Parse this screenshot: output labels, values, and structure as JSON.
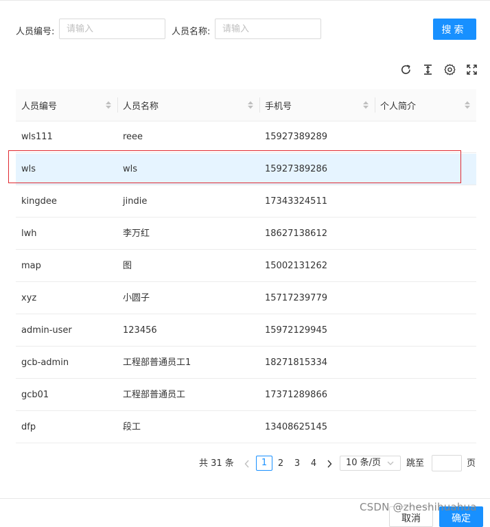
{
  "filters": {
    "code_label": "人员编号:",
    "code_placeholder": "请输入",
    "name_label": "人员名称:",
    "name_placeholder": "请输入",
    "search_label": "搜索"
  },
  "toolbar": {
    "icons": [
      "refresh-icon",
      "column-height-icon",
      "settings-icon",
      "fullscreen-icon"
    ]
  },
  "table": {
    "columns": [
      "人员编号",
      "人员名称",
      "手机号",
      "个人简介"
    ],
    "rows": [
      {
        "code": "wls111",
        "name": "reee",
        "phone": "15927389289",
        "intro": ""
      },
      {
        "code": "wls",
        "name": "wls",
        "phone": "15927389286",
        "intro": ""
      },
      {
        "code": "kingdee",
        "name": "jindie",
        "phone": "17343324511",
        "intro": ""
      },
      {
        "code": "lwh",
        "name": "李万红",
        "phone": "18627138612",
        "intro": ""
      },
      {
        "code": "map",
        "name": "图",
        "phone": "15002131262",
        "intro": ""
      },
      {
        "code": "xyz",
        "name": "小圆子",
        "phone": "15717239779",
        "intro": ""
      },
      {
        "code": "admin-user",
        "name": "123456",
        "phone": "15972129945",
        "intro": ""
      },
      {
        "code": "gcb-admin",
        "name": "工程部普通员工1",
        "phone": "18271815334",
        "intro": ""
      },
      {
        "code": "gcb01",
        "name": "工程部普通员工",
        "phone": "17371289866",
        "intro": ""
      },
      {
        "code": "dfp",
        "name": "段工",
        "phone": "13408625145",
        "intro": ""
      }
    ],
    "selected_index": 1
  },
  "pagination": {
    "total": "共 31 条",
    "pages": [
      "1",
      "2",
      "3",
      "4"
    ],
    "current": "1",
    "page_size": "10 条/页",
    "jump_label": "跳至",
    "page_unit": "页"
  },
  "footer": {
    "cancel_label": "取消",
    "ok_label": "确定",
    "watermark": "CSDN @zheshihuahua"
  },
  "colors": {
    "primary": "#1890ff",
    "selected_row": "#e6f4ff",
    "highlight_border": "#e0282e"
  }
}
